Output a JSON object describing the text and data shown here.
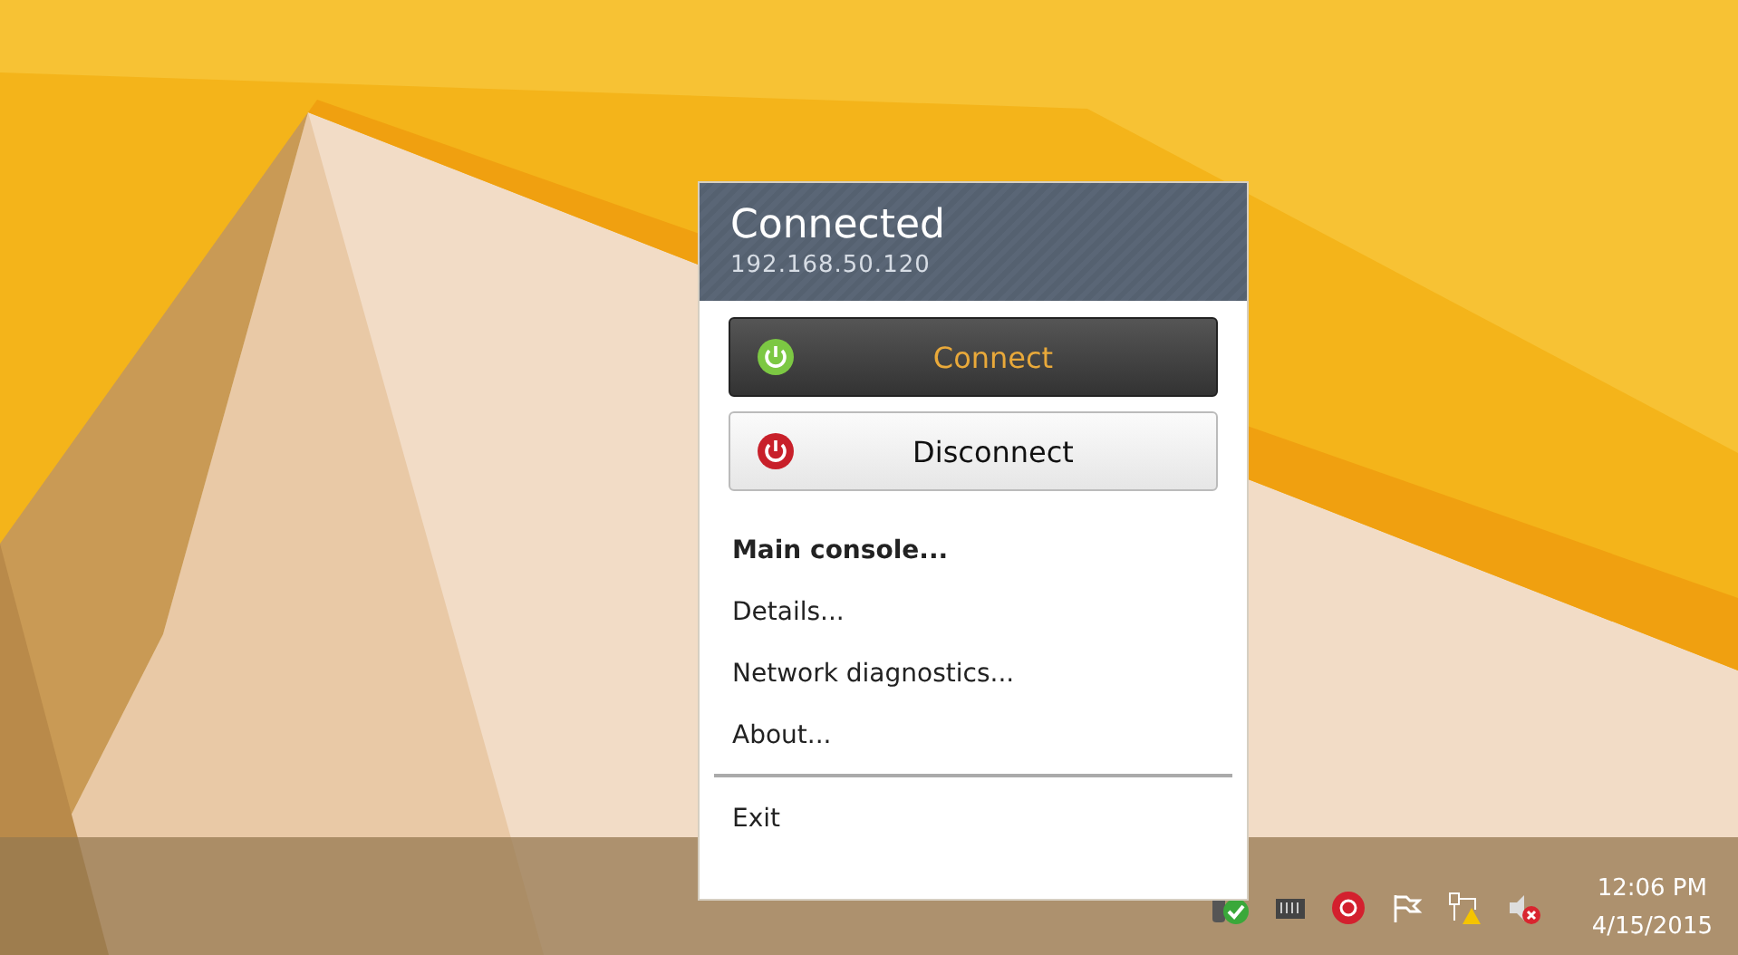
{
  "popup": {
    "title": "Connected",
    "address": "192.168.50.120",
    "buttons": [
      {
        "label": "Connect",
        "kind": "connect",
        "highlighted": true
      },
      {
        "label": "Disconnect",
        "kind": "disconnect",
        "highlighted": false
      }
    ],
    "menu": [
      {
        "label": "Main console...",
        "default": true
      },
      {
        "label": "Details...",
        "default": false
      },
      {
        "label": "Network diagnostics...",
        "default": false
      },
      {
        "label": "About...",
        "default": false
      }
    ],
    "exit": "Exit"
  },
  "taskbar": {
    "time": "12:06 PM",
    "date": "4/15/2015"
  }
}
